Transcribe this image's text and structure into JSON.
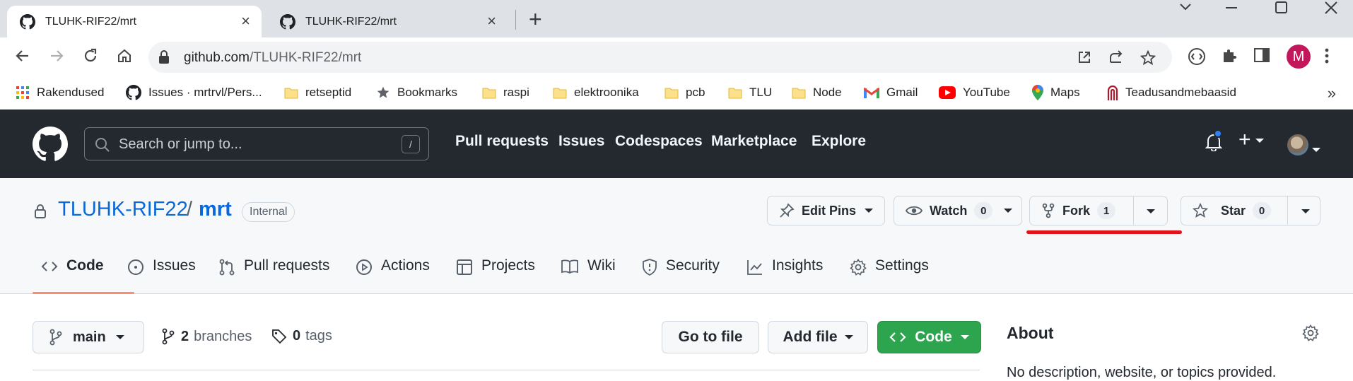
{
  "browser": {
    "tabs": [
      {
        "title": "TLUHK-RIF22/mrt",
        "active": true
      },
      {
        "title": "TLUHK-RIF22/mrt",
        "active": false
      }
    ],
    "url_host": "github.com",
    "url_path": "/TLUHK-RIF22/mrt",
    "profile_initial": "M",
    "bookmarks": [
      {
        "label": "Rakendused",
        "icon": "apps-grid-icon"
      },
      {
        "label": "Issues · mrtrvl/Pers...",
        "icon": "github-icon"
      },
      {
        "label": "retseptid",
        "icon": "folder-icon"
      },
      {
        "label": "Bookmarks",
        "icon": "star-icon"
      },
      {
        "label": "raspi",
        "icon": "folder-icon"
      },
      {
        "label": "elektroonika",
        "icon": "folder-icon"
      },
      {
        "label": "pcb",
        "icon": "folder-icon"
      },
      {
        "label": "TLU",
        "icon": "folder-icon"
      },
      {
        "label": "Node",
        "icon": "folder-icon"
      },
      {
        "label": "Gmail",
        "icon": "gmail-icon"
      },
      {
        "label": "YouTube",
        "icon": "youtube-icon"
      },
      {
        "label": "Maps",
        "icon": "maps-icon"
      },
      {
        "label": "Teadusandmebaasid",
        "icon": "arch-icon"
      }
    ],
    "bookmarks_more": "»"
  },
  "github": {
    "search_placeholder": "Search or jump to...",
    "search_key": "/",
    "nav": [
      "Pull requests",
      "Issues",
      "Codespaces",
      "Marketplace",
      "Explore"
    ],
    "plus_label": "+"
  },
  "repo": {
    "owner": "TLUHK-RIF22",
    "separator": "/",
    "name": "mrt",
    "visibility": "Internal",
    "actions": {
      "edit_pins": "Edit Pins",
      "watch": "Watch",
      "watch_count": "0",
      "fork": "Fork",
      "fork_count": "1",
      "star": "Star",
      "star_count": "0"
    },
    "tabs": [
      "Code",
      "Issues",
      "Pull requests",
      "Actions",
      "Projects",
      "Wiki",
      "Security",
      "Insights",
      "Settings"
    ],
    "selected_tab": "Code"
  },
  "code_view": {
    "branch": "main",
    "branches_count": "2",
    "branches_label": "branches",
    "tags_count": "0",
    "tags_label": "tags",
    "go_to_file": "Go to file",
    "add_file": "Add file",
    "code_button": "Code",
    "about_title": "About",
    "about_text": "No description, website, or topics provided."
  },
  "colors": {
    "header_bg": "#24292f",
    "link": "#0969da",
    "code_button": "#2da44e",
    "annotation": "#e0141b",
    "tab_underline": "#fd8c73"
  }
}
